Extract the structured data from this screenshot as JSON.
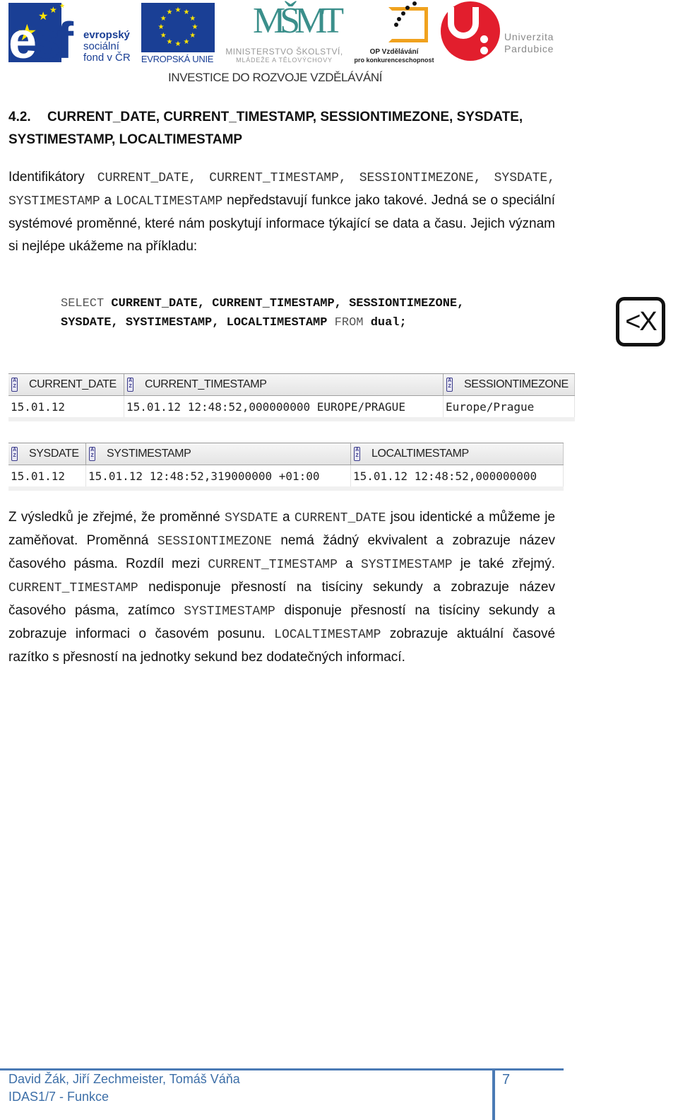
{
  "header": {
    "logos": {
      "esf": {
        "line1": "evropský",
        "line2": "sociální",
        "line3": "fond v ČR",
        "mark": "esf"
      },
      "eu": {
        "label": "EVROPSKÁ UNIE"
      },
      "msmt": {
        "mark": "MŠMT",
        "line1": "MINISTERSTVO ŠKOLSTVÍ,",
        "line2": "MLÁDEŽE A TĚLOVÝCHOVY"
      },
      "op": {
        "line1": "OP Vzdělávání",
        "line2": "pro konkurenceschopnost"
      },
      "upce": {
        "line1": "Univerzita",
        "line2": "Pardubice"
      }
    },
    "tagline": "INVESTICE DO ROZVOJE VZDĚLÁVÁNÍ"
  },
  "section": {
    "number": "4.2.",
    "title_parts": [
      "CURRENT_DATE,",
      "CURRENT_TIMESTAMP,",
      "SESSIONTIMEZONE,",
      "SYSDATE,"
    ],
    "title_line2": "SYSTIMESTAMP, LOCALTIMESTAMP"
  },
  "intro": {
    "t1": "Identifikátory",
    "c1": "CURRENT_DATE,",
    "c2": "CURRENT_TIMESTAMP,",
    "c3": "SESSIONTIMEZONE,",
    "c4": "SYSDATE,",
    "c5": "SYSTIMESTAMP",
    "t2": "a",
    "c6": "LOCALTIMESTAMP",
    "t3": "nepředstavují funkce jako takové. Jedná se o speciální systémové proměnné, které nám poskytují informace týkající se data a času. Jejich význam si nejlépe ukážeme na příkladu:"
  },
  "code": {
    "select": "SELECT",
    "line1_cols": "CURRENT_DATE, CURRENT_TIMESTAMP, SESSIONTIMEZONE,",
    "line2_cols": "SYSDATE, SYSTIMESTAMP, LOCALTIMESTAMP",
    "from": "FROM",
    "table": "dual;",
    "icon_label": "<X"
  },
  "result1": {
    "columns": [
      "CURRENT_DATE",
      "CURRENT_TIMESTAMP",
      "SESSIONTIMEZONE"
    ],
    "row": [
      "15.01.12",
      "15.01.12 12:48:52,000000000 EUROPE/PRAGUE",
      "Europe/Prague"
    ]
  },
  "result2": {
    "columns": [
      "SYSDATE",
      "SYSTIMESTAMP",
      "LOCALTIMESTAMP"
    ],
    "row": [
      "15.01.12",
      "15.01.12 12:48:52,319000000 +01:00",
      "15.01.12 12:48:52,000000000"
    ]
  },
  "explanation": {
    "t1": "Z výsledků je zřejmé, že proměnné",
    "c1": "SYSDATE",
    "t2": "a",
    "c2": "CURRENT_DATE",
    "t3": "jsou identické a můžeme je zaměňovat. Proměnná",
    "c3": "SESSIONTIMEZONE",
    "t4": "nemá žádný ekvivalent a zobrazuje název časového pásma. Rozdíl mezi",
    "c4": "CURRENT_TIMESTAMP",
    "t5": "a",
    "c5": "SYSTIMESTAMP",
    "t6": "je také zřejmý.",
    "c6": "CURRENT_TIMESTAMP",
    "t7": "nedisponuje přesností na tisíciny sekundy a zobrazuje název časového pásma, zatímco",
    "c7": "SYSTIMESTAMP",
    "t8": "disponuje přesností na tisíciny sekundy a zobrazuje informaci o časovém posunu.",
    "c8": "LOCALTIMESTAMP",
    "t9": "zobrazuje aktuální časové razítko s přesností na jednotky sekund bez dodatečných informací."
  },
  "footer": {
    "authors": "David Žák, Jiří Zechmeister, Tomáš Váňa",
    "course": "IDAS1/7 - Funkce",
    "page": "7"
  },
  "colors": {
    "footer_accent": "#4a7ab5",
    "esf_blue": "#1a3f95",
    "upce_red": "#e21e2d",
    "op_orange": "#f0a21e",
    "msmt_teal": "#3b8f8b"
  }
}
